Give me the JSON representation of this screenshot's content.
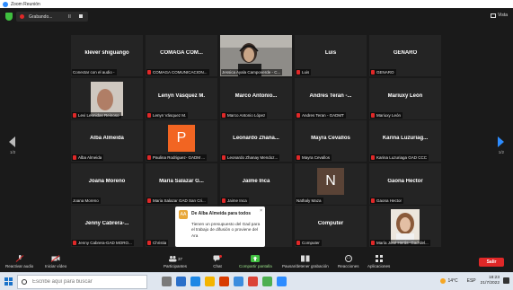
{
  "window": {
    "title": "Zoom Reunión"
  },
  "topbar": {
    "recording_label": "Grabando...",
    "view_label": "Vista",
    "pause_glyph": "II"
  },
  "pagination": {
    "left": "1/2",
    "right": "1/2"
  },
  "tiles": [
    {
      "name": "klever shiguango",
      "label": "Conectar con el audio -",
      "mic": false
    },
    {
      "name": "COMAGA COM...",
      "label": "COMAGA COMUNICACION...",
      "mic": true
    },
    {
      "name": "",
      "label": "Jessica Ayala Campoverde - C...",
      "mic": false,
      "active": true,
      "video": "woman-headset"
    },
    {
      "name": "Luis",
      "label": "Luis",
      "mic": true
    },
    {
      "name": "GENARO",
      "label": "GENARO",
      "mic": true
    },
    {
      "name": "",
      "label": "Levi Leonidas Reinoso",
      "mic": true,
      "video": "hand"
    },
    {
      "name": "Lenyn Vásquez M.",
      "label": "Lenyn Vásquez M.",
      "mic": true
    },
    {
      "name": "Marco Antonio...",
      "label": "Marco Antonio López",
      "mic": true
    },
    {
      "name": "Andres Teran -...",
      "label": "Andres Teran - GADMT",
      "mic": true
    },
    {
      "name": "Mariuxy León",
      "label": "Mariuxy León",
      "mic": true
    },
    {
      "name": "Alba Almeida",
      "label": "Alba Almeida",
      "mic": true
    },
    {
      "name": "",
      "label": "Paulina Rodriguez- GADM ...",
      "mic": true,
      "avatar": "P"
    },
    {
      "name": "Leonardo Zhana...",
      "label": "Leonardo Zhanay Mendoz...",
      "mic": true
    },
    {
      "name": "Mayra Cevallos",
      "label": "Mayra Cevallos",
      "mic": true
    },
    {
      "name": "Karina Luzuriag...",
      "label": "Karina Luzuriaga GAD CCC",
      "mic": true
    },
    {
      "name": "Joana Moreno",
      "label": "Joana Moreno",
      "mic": false
    },
    {
      "name": "Maria Salazar G...",
      "label": "Maria Salazar GAD San Cri...",
      "mic": true
    },
    {
      "name": "Jaime Inca",
      "label": "Jaime Inca",
      "mic": true
    },
    {
      "name": "",
      "label": "Nathaly Maza",
      "mic": false,
      "avatar": "N"
    },
    {
      "name": "Gaona Hector",
      "label": "Gaona Hector",
      "mic": true
    },
    {
      "name": "Jenny Cabrera-...",
      "label": "Jenny Cabrera-GAD MORO...",
      "mic": true
    },
    {
      "name": "Chri",
      "label": "Christia",
      "mic": true
    },
    {
      "name": "Tac...",
      "label": "GADM Y...",
      "mic": true
    },
    {
      "name": "Computer",
      "label": "Computer",
      "mic": true
    },
    {
      "name": "",
      "label": "María José Herás- Gad del...",
      "mic": true,
      "video": "woman"
    }
  ],
  "toast": {
    "avatar_letter": "AA",
    "title": "De Alba Almeida para todos",
    "body": "Tienen un presupuesto del Gad para el trabajo de difusión o proviene del Ara",
    "close": "×"
  },
  "toolbar": {
    "mute": "Reactivar audio",
    "video": "Iniciar vídeo",
    "participants": "Participantes",
    "participants_count": "37",
    "chat": "Chat",
    "chat_badge": "1",
    "share": "Compartir pantalla",
    "record": "Pausar/detener grabación",
    "reactions": "Reacciones",
    "apps": "Aplicaciones",
    "leave": "Salir"
  },
  "taskbar": {
    "search_placeholder": "Escribe aquí para buscar",
    "weather": "14°C",
    "lang": "ESP",
    "time": "18:23",
    "date": "21/7/2022"
  },
  "colors": {
    "accent": "#2d8cff",
    "active_speaker": "#d7e84a",
    "muted": "#e02828",
    "leave": "#e02828"
  }
}
